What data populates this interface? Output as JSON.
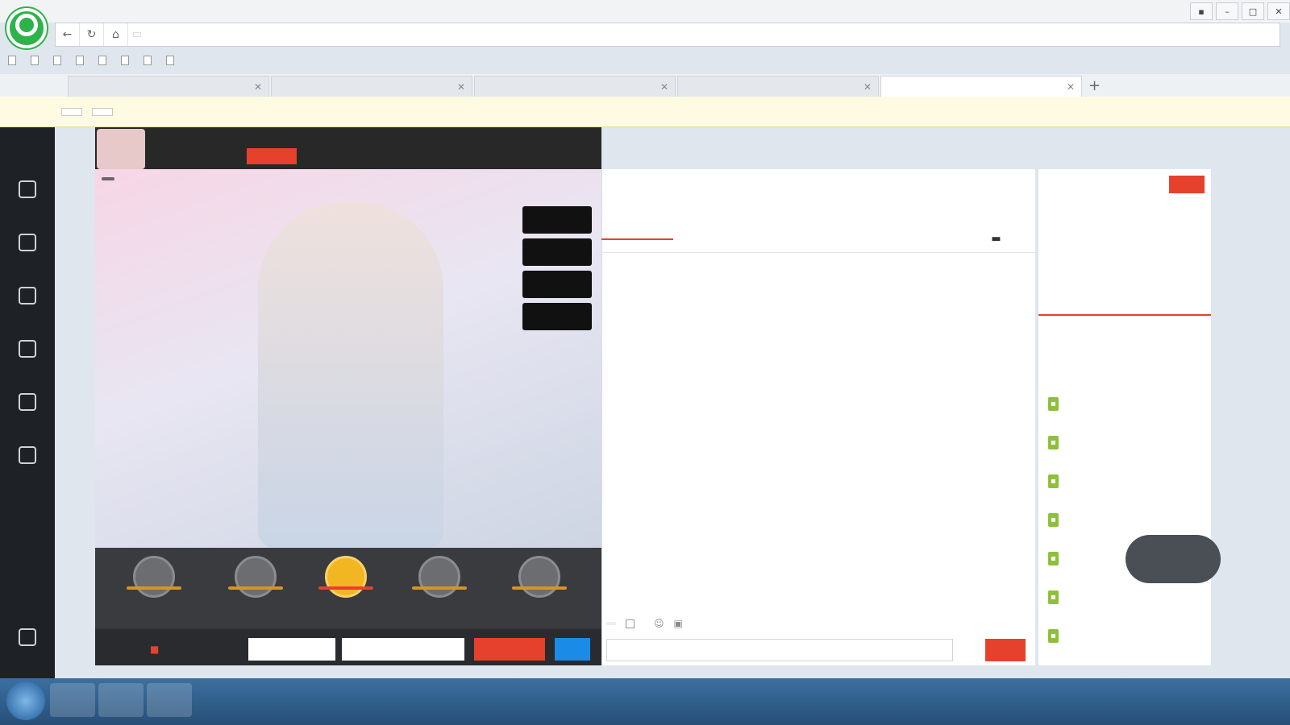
{
  "browser": {
    "title": "",
    "url": "",
    "site_badge": "",
    "menu_label": "",
    "bookmarks": [
      {
        "label": ""
      },
      {
        "label": ""
      },
      {
        "label": ""
      },
      {
        "label": ""
      },
      {
        "label": ""
      },
      {
        "label": ""
      },
      {
        "label": ""
      },
      {
        "label": ""
      }
    ],
    "tabs": [
      {
        "label": ""
      },
      {
        "label": ""
      },
      {
        "label": ""
      },
      {
        "label": ""
      },
      {
        "label": ""
      }
    ],
    "infobar": {
      "text": "",
      "set_default_label": "",
      "close_label": ""
    }
  },
  "overlay": {
    "caption_top": "",
    "caption_mid": ""
  },
  "sidebar": {
    "logo": "",
    "items": [
      {
        "label": ""
      },
      {
        "label": ""
      },
      {
        "label": ""
      },
      {
        "label": ""
      },
      {
        "label": ""
      },
      {
        "label": ""
      }
    ],
    "mobile_label": ""
  },
  "host": {
    "name": "",
    "start_time": "",
    "location": "",
    "follow_label": "",
    "badge_count": "",
    "stats_text": ""
  },
  "stage": {
    "buttons": [
      {
        "label": ""
      },
      {
        "label": ""
      },
      {
        "label": ""
      },
      {
        "label": ""
      }
    ],
    "seats": [
      {
        "label": ""
      },
      {
        "label": ""
      },
      {
        "label": ""
      },
      {
        "label": ""
      },
      {
        "label": ""
      }
    ],
    "gift_box_label": "",
    "quantity_placeholder": "",
    "recipient_text": "",
    "send_gift_label": "",
    "recharge_label": ""
  },
  "ranking": {
    "label": "",
    "rows": [
      {
        "rank": "",
        "name": "",
        "score": ""
      },
      {
        "rank": "",
        "name": "",
        "score": ""
      }
    ]
  },
  "chat": {
    "tabs": [
      {
        "label": ""
      },
      {
        "label": ""
      },
      {
        "label": ""
      },
      {
        "label": ""
      },
      {
        "label": ""
      }
    ],
    "announcement": "",
    "messages": [
      {
        "text": ""
      },
      {
        "text": ""
      },
      {
        "text": ""
      },
      {
        "text": ""
      },
      {
        "text": ""
      },
      {
        "text": ""
      },
      {
        "text": ""
      },
      {
        "text": ""
      }
    ],
    "target_user": "",
    "whisper_label": "",
    "input_placeholder": "",
    "send_label": ""
  },
  "guard": {
    "title": "",
    "empty_text": "",
    "open_label": ""
  },
  "audience": {
    "tabs": [
      {
        "label": "",
        "count": ""
      },
      {
        "label": "",
        "count": ""
      },
      {
        "label": "",
        "count": ""
      }
    ],
    "users": [
      {
        "name": ""
      },
      {
        "name": ""
      },
      {
        "name": ""
      },
      {
        "name": ""
      },
      {
        "name": ""
      },
      {
        "name": ""
      },
      {
        "name": ""
      },
      {
        "name": ""
      }
    ]
  },
  "speed": {
    "percent": "",
    "up": "",
    "down": ""
  },
  "taskbar": {
    "time": "",
    "date": ""
  },
  "colors": {
    "accent": "#e6412c",
    "brand_green": "#2db34a",
    "caption_green": "#3bd42f"
  }
}
